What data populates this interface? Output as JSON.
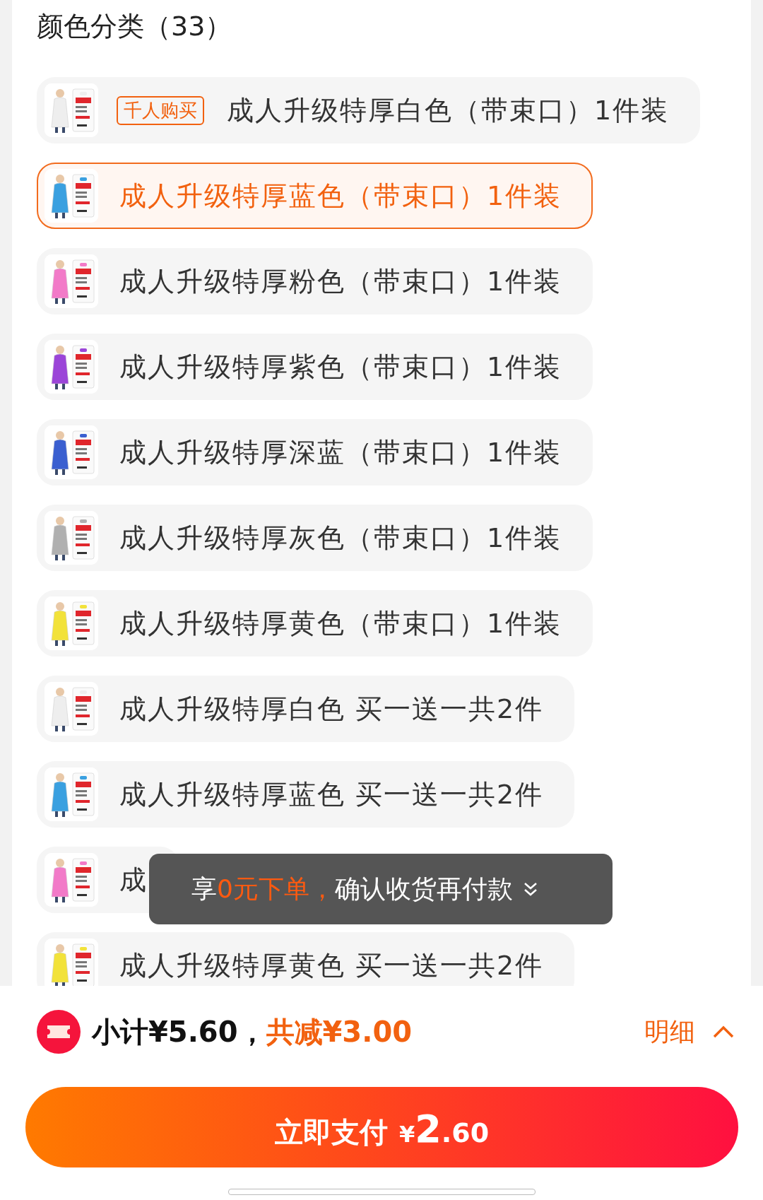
{
  "header": {
    "title": "颜色分类（33）"
  },
  "options": [
    {
      "label": "成人升级特厚白色（带束口）1件装",
      "badge": "千人购买",
      "selected": false,
      "color": "#eeeeee"
    },
    {
      "label": "成人升级特厚蓝色（带束口）1件装",
      "selected": true,
      "color": "#3aa0e0"
    },
    {
      "label": "成人升级特厚粉色（带束口）1件装",
      "selected": false,
      "color": "#f27ac8"
    },
    {
      "label": "成人升级特厚紫色（带束口）1件装",
      "selected": false,
      "color": "#9b45d8"
    },
    {
      "label": "成人升级特厚深蓝（带束口）1件装",
      "selected": false,
      "color": "#3a5fd0"
    },
    {
      "label": "成人升级特厚灰色（带束口）1件装",
      "selected": false,
      "color": "#b0b0b0"
    },
    {
      "label": "成人升级特厚黄色（带束口）1件装",
      "selected": false,
      "color": "#f2e23a"
    },
    {
      "label": "成人升级特厚白色 买一送一共2件",
      "selected": false,
      "color": "#eeeeee"
    },
    {
      "label": "成人升级特厚蓝色 买一送一共2件",
      "selected": false,
      "color": "#3aa0e0"
    },
    {
      "label": "成",
      "selected": false,
      "color": "#f27ac8"
    },
    {
      "label": "成人升级特厚黄色 买一送一共2件",
      "selected": false,
      "color": "#f2e23a"
    }
  ],
  "toast": {
    "text": "享**0元下单，**确认收货再付款"
  },
  "summary": {
    "subtotal": "小计¥5.60，",
    "discount": "共减¥3.00",
    "details": "明细"
  },
  "pay_button": {
    "label": "立即支付",
    "currency": "¥",
    "amount_int": "2",
    "amount_dec": ".60"
  }
}
